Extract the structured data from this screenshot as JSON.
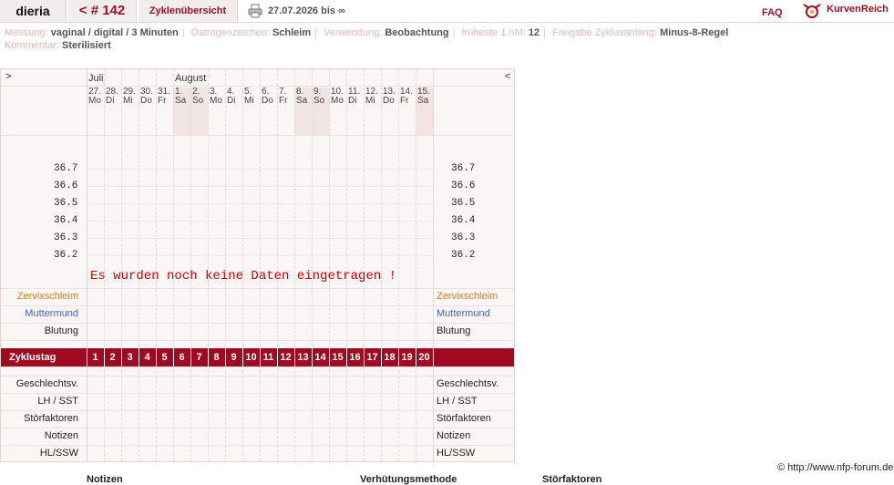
{
  "header": {
    "user": "dieria",
    "cycle": "< # 142",
    "overview": "Zyklenübersicht",
    "date_range": "27.07.2026 bis ∞",
    "faq": "FAQ",
    "brand": "KurvenReich"
  },
  "meta": {
    "messung_label": "Messung:",
    "messung_value": "vaginal / digital / 3 Minuten",
    "oestrogen_label": "Östrogenzeichen:",
    "oestrogen_value": "Schleim",
    "verwendung_label": "Verwendung:",
    "verwendung_value": "Beobachtung",
    "hm_label": "früheste 1.hM:",
    "hm_value": "12",
    "freigabe_label": "Freigabe Zyklusanfang:",
    "freigabe_value": "Minus-8-Regel",
    "kommentar_label": "Kommentar:",
    "kommentar_value": "Sterilisiert"
  },
  "chart": {
    "nav_prev": ">",
    "nav_next": "<",
    "months": [
      "Juli",
      "August"
    ],
    "days": [
      {
        "d": "27.",
        "w": "Mo"
      },
      {
        "d": "28.",
        "w": "Di"
      },
      {
        "d": "29.",
        "w": "Mi"
      },
      {
        "d": "30.",
        "w": "Do"
      },
      {
        "d": "31.",
        "w": "Fr"
      },
      {
        "d": "1.",
        "w": "Sa"
      },
      {
        "d": "2.",
        "w": "So"
      },
      {
        "d": "3.",
        "w": "Mo"
      },
      {
        "d": "4.",
        "w": "Di"
      },
      {
        "d": "5.",
        "w": "Mi"
      },
      {
        "d": "6.",
        "w": "Do"
      },
      {
        "d": "7.",
        "w": "Fr"
      },
      {
        "d": "8.",
        "w": "Sa"
      },
      {
        "d": "9.",
        "w": "So"
      },
      {
        "d": "10.",
        "w": "Mo"
      },
      {
        "d": "11.",
        "w": "Di"
      },
      {
        "d": "12.",
        "w": "Mi"
      },
      {
        "d": "13.",
        "w": "Do"
      },
      {
        "d": "14.",
        "w": "Fr"
      },
      {
        "d": "15.",
        "w": "Sa"
      }
    ],
    "temps": [
      "36.7",
      "36.6",
      "36.5",
      "36.4",
      "36.3",
      "36.2"
    ],
    "no_data": "Es wurden noch keine Daten eingetragen !",
    "rows_top": {
      "zervix": "Zervixschleim",
      "muttermund": "Muttermund",
      "blutung": "Blutung"
    },
    "zyklustag_label": "Zyklustag",
    "cycle_days": [
      "1",
      "2",
      "3",
      "4",
      "5",
      "6",
      "7",
      "8",
      "9",
      "10",
      "11",
      "12",
      "13",
      "14",
      "15",
      "16",
      "17",
      "18",
      "19",
      "20"
    ],
    "rows_bottom": [
      "Geschlechtsv.",
      "LH / SST",
      "Störfaktoren",
      "Notizen",
      "HL/SSW"
    ],
    "colors": {
      "zervix": "#e07a10",
      "muttermund": "#4b5fcc",
      "accent": "#a0091f"
    }
  },
  "footer": {
    "copyright": "© http://www.nfp-forum.de",
    "col1": "Notizen",
    "col2": "Verhütungsmethode",
    "col3": "Störfaktoren"
  }
}
